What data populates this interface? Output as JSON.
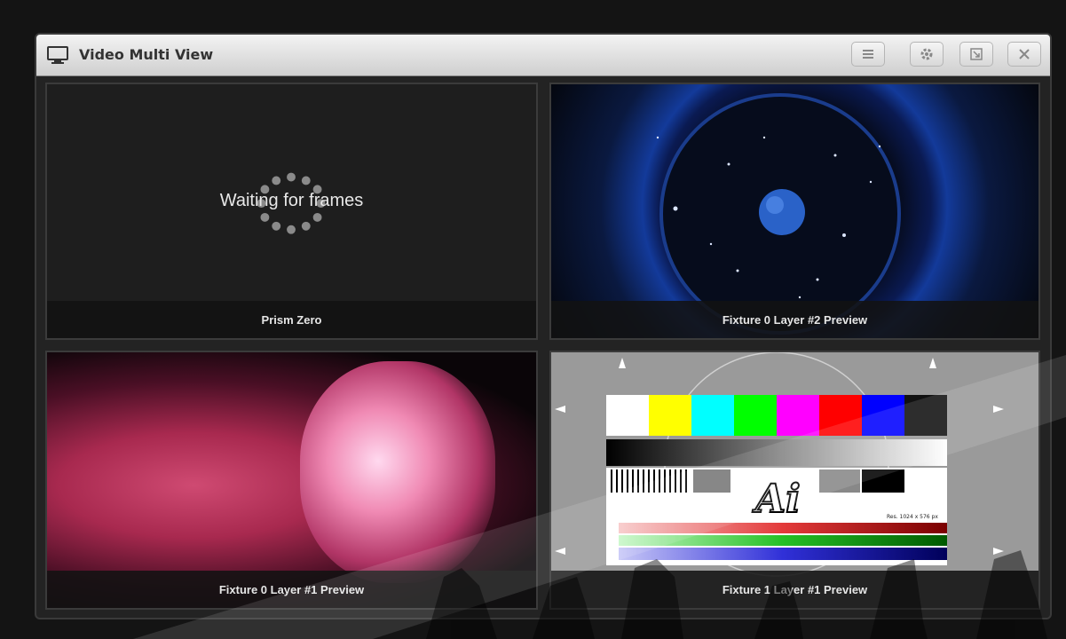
{
  "window": {
    "title": "Video Multi View",
    "icon": "monitor-icon",
    "buttons": [
      "menu-icon",
      "settings-icon",
      "restore-icon",
      "close-icon"
    ]
  },
  "panels": [
    {
      "label": "Prism Zero",
      "status": "Waiting for frames"
    },
    {
      "label": "Fixture 0 Layer #2 Preview"
    },
    {
      "label": "Fixture 0 Layer #1 Preview"
    },
    {
      "label": "Fixture 1 Layer #1 Preview",
      "test_card": {
        "logo": "Ai",
        "resolution_text": "Res. 1024 x 576 px"
      }
    }
  ],
  "colors": {
    "background": "#141414",
    "window": "#232323",
    "titlebar": "#dcdcdc",
    "color_bars": [
      "#ffffff",
      "#ffff00",
      "#00ffff",
      "#00ff00",
      "#ff00ff",
      "#ff0000",
      "#0000ff",
      "#111111"
    ]
  }
}
